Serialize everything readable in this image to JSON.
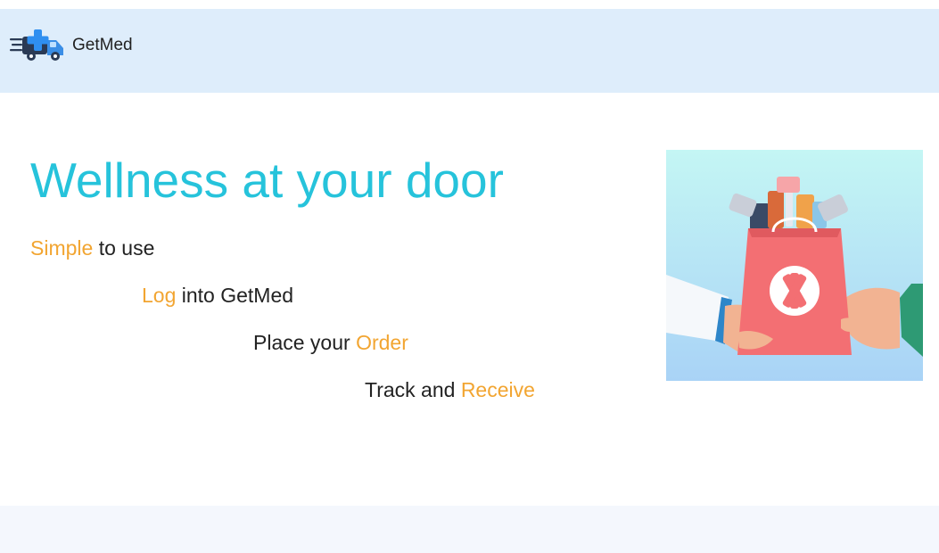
{
  "brand": {
    "name": "GetMed",
    "logo_icon": "delivery-truck-medical-icon"
  },
  "hero": {
    "title": "Wellness at your door",
    "steps": [
      {
        "highlight": "Simple",
        "text": " to use",
        "highlight_first": true
      },
      {
        "highlight": "Log",
        "text": " into GetMed",
        "highlight_first": true
      },
      {
        "text": "Place your ",
        "highlight": "Order",
        "highlight_first": false
      },
      {
        "text": "Track and ",
        "highlight": "Receive",
        "highlight_first": false
      }
    ],
    "image_icon": "medicine-bag-handoff-illustration"
  },
  "colors": {
    "navbar_bg": "#deedfb",
    "title": "#26c3db",
    "highlight": "#f2a531",
    "footer_bg": "#f4f7fd"
  }
}
